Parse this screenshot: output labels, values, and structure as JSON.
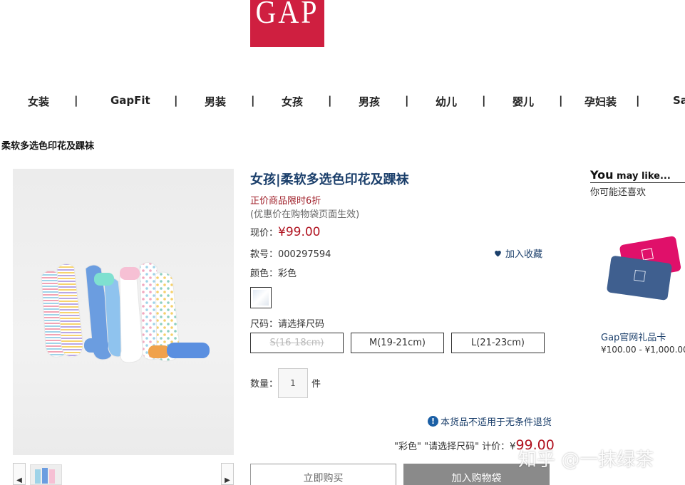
{
  "brand": {
    "logo_text": "GAP",
    "color": "#cf1f40"
  },
  "nav": {
    "items": [
      "女装",
      "GapFit",
      "男装",
      "女孩",
      "男孩",
      "幼儿",
      "婴儿",
      "孕妇装",
      "Sa"
    ],
    "separator": "|"
  },
  "breadcrumb": "柔软多选色印花及踝袜",
  "product": {
    "title": "女孩|柔软多选色印花及踝袜",
    "promo": "正价商品限时6折",
    "promo_note": "(优惠价在购物袋页面生效)",
    "price_label": "现价：",
    "price": "¥99.00",
    "sku_label": "款号：",
    "sku": "000297594",
    "favorite_label": "加入收藏",
    "color_label": "颜色：",
    "color_value": "彩色",
    "size_label": "尺码：",
    "size_value": "请选择尺码",
    "sizes": [
      {
        "label": "S(16-18cm)",
        "available": false
      },
      {
        "label": "M(19-21cm)",
        "available": true
      },
      {
        "label": "L(21-23cm)",
        "available": true
      }
    ],
    "qty_label": "数量：",
    "qty": "1",
    "qty_unit": "件",
    "return_notice": "本货品不适用于无条件退货",
    "summary_text": "\"彩色\" \"请选择尺码\"  计价：¥",
    "summary_total": "99.00",
    "buy_now_label": "立即购买",
    "add_cart_label": "加入购物袋"
  },
  "sidebar": {
    "title_big": "You",
    "title_small": " may like...",
    "subtitle": "你可能还喜欢",
    "item_name": "Gap官网礼品卡",
    "item_price": "¥100.00 - ¥1,000.00"
  },
  "watermark": "知乎 @一抹绿茶",
  "colors": {
    "accent_navy": "#1b3f6b",
    "price_red": "#b0121f",
    "cart_gray": "#8a8a8a"
  }
}
